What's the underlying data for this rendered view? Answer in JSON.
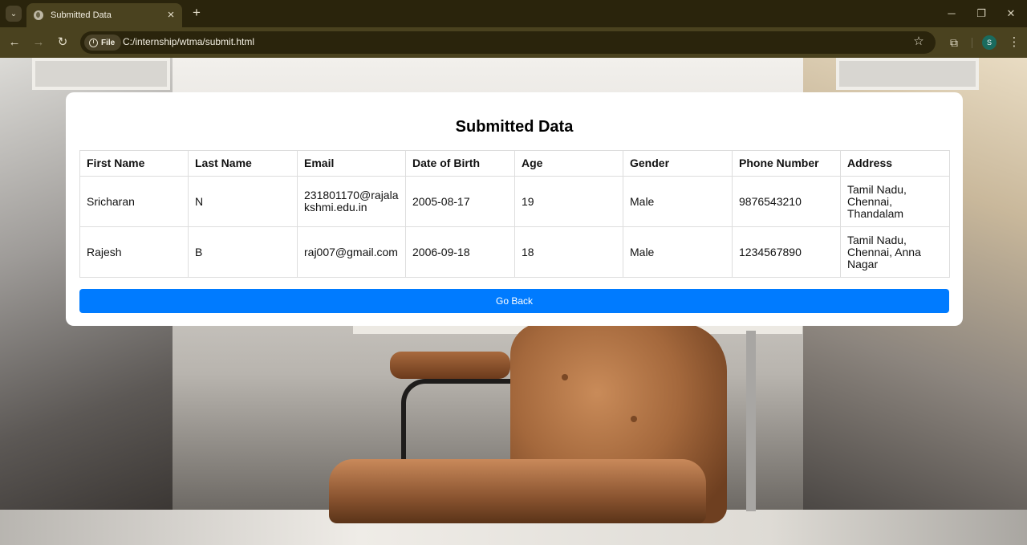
{
  "browser": {
    "tab_title": "Submitted Data",
    "new_tab_label": "+",
    "address_chip": "File",
    "url": "C:/internship/wtma/submit.html",
    "profile_initial": "S"
  },
  "page": {
    "title": "Submitted Data",
    "table": {
      "headers": [
        "First Name",
        "Last Name",
        "Email",
        "Date of Birth",
        "Age",
        "Gender",
        "Phone Number",
        "Address"
      ],
      "rows": [
        [
          "Sricharan",
          "N",
          "231801170@rajalakshmi.edu.in",
          "2005-08-17",
          "19",
          "Male",
          "9876543210",
          "Tamil Nadu, Chennai, Thandalam"
        ],
        [
          "Rajesh",
          "B",
          "raj007@gmail.com",
          "2006-09-18",
          "18",
          "Male",
          "1234567890",
          "Tamil Nadu, Chennai, Anna Nagar"
        ]
      ]
    },
    "go_back_label": "Go Back",
    "button_color": "#007bff"
  }
}
